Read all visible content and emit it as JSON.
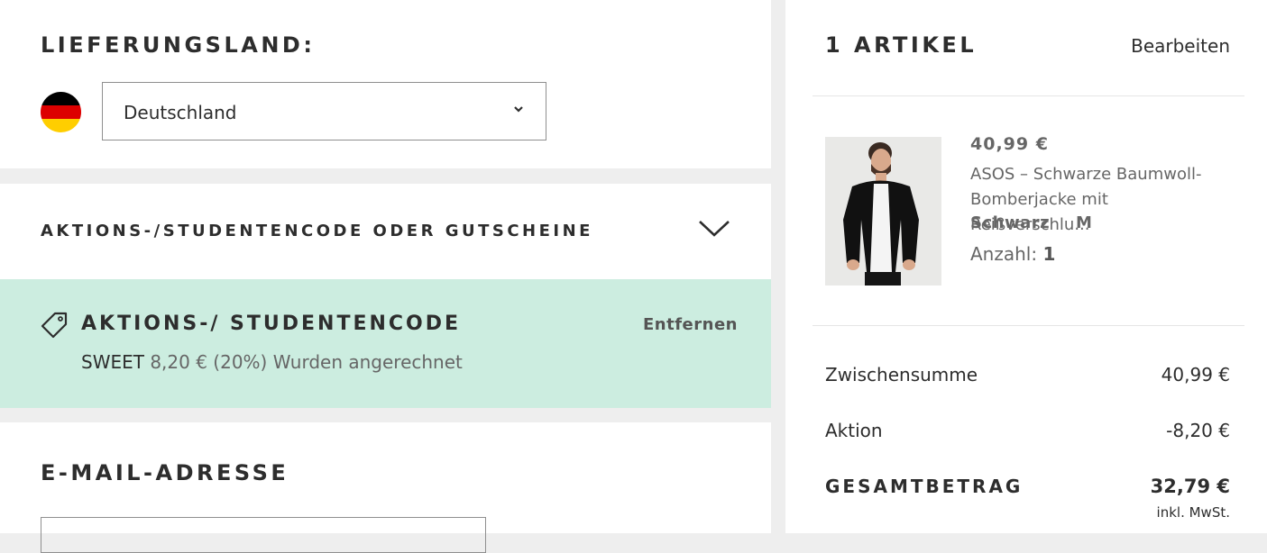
{
  "delivery": {
    "title": "LIEFERUNGSLAND:",
    "selected_country": "Deutschland",
    "flag_colors": [
      "#000000",
      "#dd0000",
      "#ffce00"
    ],
    "flag_icon": "germany-flag-icon",
    "chevron_icon": "chevron-down-icon"
  },
  "promo": {
    "accordion_title": "AKTIONS-/STUDENTENCODE ODER GUTSCHEINE",
    "toggle_icon": "chevron-down-icon",
    "applied": {
      "title": "AKTIONS-/ STUDENTENCODE",
      "code": "SWEET",
      "description": " 8,20 € (20%) Wurden angerechnet",
      "remove_label": "Entfernen",
      "icon": "tag-icon",
      "background_color": "#ccede0"
    }
  },
  "email": {
    "title": "E-MAIL-ADRESSE",
    "value": ""
  },
  "summary": {
    "items_title": "1 ARTIKEL",
    "edit_label": "Bearbeiten",
    "product": {
      "price": "40,99 €",
      "name": "ASOS – Schwarze Baumwoll-Bomberjacke mit Reißverschlu...",
      "color": "Schwarz",
      "size": "M",
      "quantity_label": "Anzahl:",
      "quantity": "1"
    },
    "subtotal_label": "Zwischensumme",
    "subtotal_value": "40,99 €",
    "discount_label": "Aktion",
    "discount_value": "-8,20 €",
    "total_label": "GESAMTBETRAG",
    "total_value": "32,79 €",
    "vat_note": "inkl. MwSt."
  }
}
